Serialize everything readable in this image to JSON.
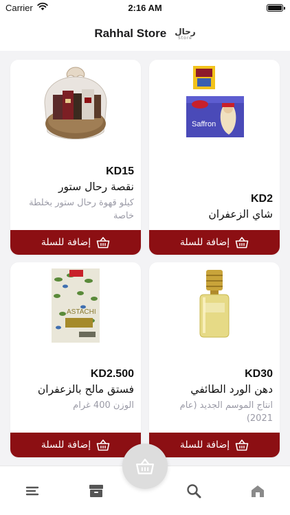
{
  "status_bar": {
    "carrier": "Carrier",
    "time": "2:16 AM"
  },
  "header": {
    "title": "Rahhal Store",
    "logo_ar": "رحال",
    "logo_en": "Store"
  },
  "products": [
    {
      "price": "KD15",
      "name": "نقصة رحال ستور",
      "description": "كيلو قهوة رحال ستور بخلطة خاصة",
      "button": "إضافة للسلة",
      "image": "gift-basket-image"
    },
    {
      "price": "KD2",
      "name": "شاي الزعفران",
      "description": "",
      "button": "إضافة للسلة",
      "image": "saffron-tea-image"
    },
    {
      "price": "KD2.500",
      "name": "فستق مالح بالزعفران",
      "description": "الوزن 400 غرام",
      "button": "إضافة للسلة",
      "image": "pistachio-bag-image"
    },
    {
      "price": "KD30",
      "name": "دهن الورد الطائفي",
      "description": "انتاج الموسم الجديد (عام 2021)",
      "button": "إضافة للسلة",
      "image": "rose-oil-bottle-image"
    }
  ],
  "tabs": [
    {
      "icon": "menu-icon"
    },
    {
      "icon": "archive-icon"
    },
    {
      "icon": "search-icon"
    },
    {
      "icon": "home-icon"
    }
  ],
  "fab": {
    "icon": "basket-icon"
  },
  "colors": {
    "accent": "#8c0f13",
    "background": "#f3f3f5",
    "muted_text": "#9a9aa6"
  }
}
